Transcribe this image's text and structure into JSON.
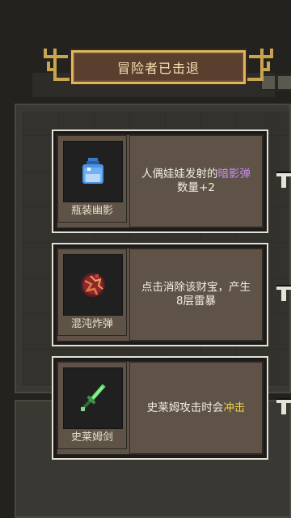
{
  "banner": {
    "title": "冒险者已击退"
  },
  "cards": [
    {
      "name": "瓶装幽影",
      "icon": "bottled-shadow-icon",
      "desc_a": "人偶娃娃发射的",
      "desc_hl": "暗影弹",
      "desc_b": "数量+2",
      "hl_color": "#c48df0"
    },
    {
      "name": "混沌炸弹",
      "icon": "chaos-bomb-icon",
      "desc_a": "点击消除该财宝，产生8层雷暴",
      "desc_hl": "",
      "desc_b": "",
      "hl_color": ""
    },
    {
      "name": "史莱姆剑",
      "icon": "slime-sword-icon",
      "desc_a": "史莱姆攻击时会",
      "desc_hl": "冲击",
      "desc_b": "",
      "hl_color": "#f1d34a"
    }
  ]
}
